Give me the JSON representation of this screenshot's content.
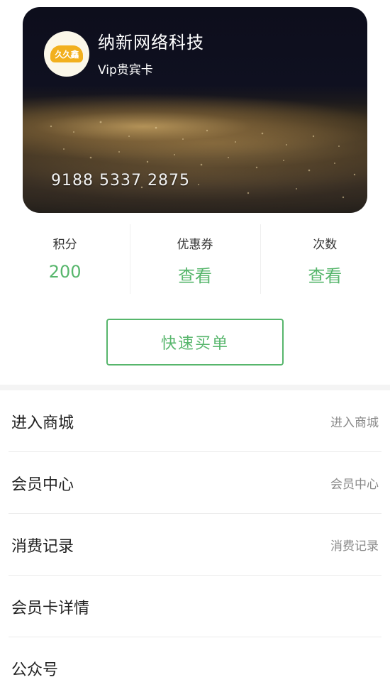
{
  "card": {
    "store_name": "纳新网络科技",
    "card_type": "Vip贵宾卡",
    "card_number": "9188 5337 2875",
    "logo_text": "久久鑫"
  },
  "stats": [
    {
      "label": "积分",
      "value": "200"
    },
    {
      "label": "优惠券",
      "value": "查看"
    },
    {
      "label": "次数",
      "value": "查看"
    }
  ],
  "quick_pay_label": "快速买单",
  "menu": [
    {
      "label": "进入商城",
      "hint": "进入商城"
    },
    {
      "label": "会员中心",
      "hint": "会员中心"
    },
    {
      "label": "消费记录",
      "hint": "消费记录"
    },
    {
      "label": "会员卡详情",
      "hint": ""
    },
    {
      "label": "公众号",
      "hint": ""
    }
  ],
  "colors": {
    "accent": "#57b66c",
    "card_dark": "#0f1020",
    "card_gold": "#c4a060"
  }
}
